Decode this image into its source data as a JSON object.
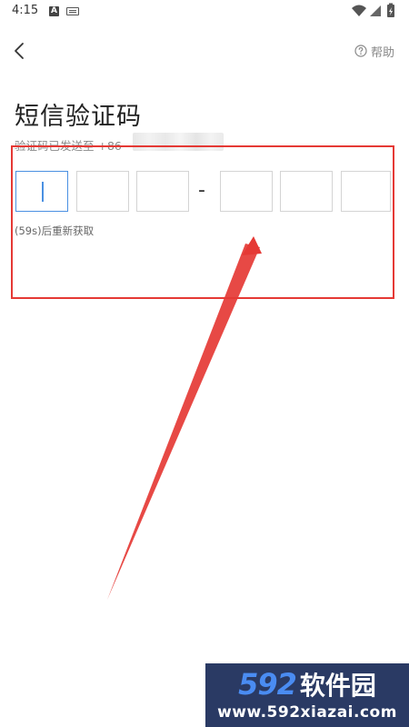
{
  "status_bar": {
    "time": "4:15",
    "left_icons": [
      "a-app-icon",
      "keyboard-icon"
    ],
    "right_icons": [
      "wifi-icon",
      "signal-icon",
      "battery-icon"
    ]
  },
  "nav": {
    "back_icon": "chevron-left-icon",
    "help_label": "帮助",
    "help_icon": "help-circle-icon"
  },
  "title": "短信验证码",
  "sent_to_text": "验证码已发送至 +86",
  "code_input": {
    "boxes": [
      "",
      "",
      "",
      "",
      "",
      ""
    ],
    "separator": "-",
    "active_index": 0
  },
  "resend_text": "(59s)后重新获取",
  "colors": {
    "accent": "#4a90e2",
    "annotation_red": "#e53935",
    "watermark_bg": "#2a3a64",
    "watermark_blue": "#4a8cf2"
  },
  "watermark": {
    "number": "592",
    "name": "软件园",
    "url": "www.592xiazai.com"
  }
}
